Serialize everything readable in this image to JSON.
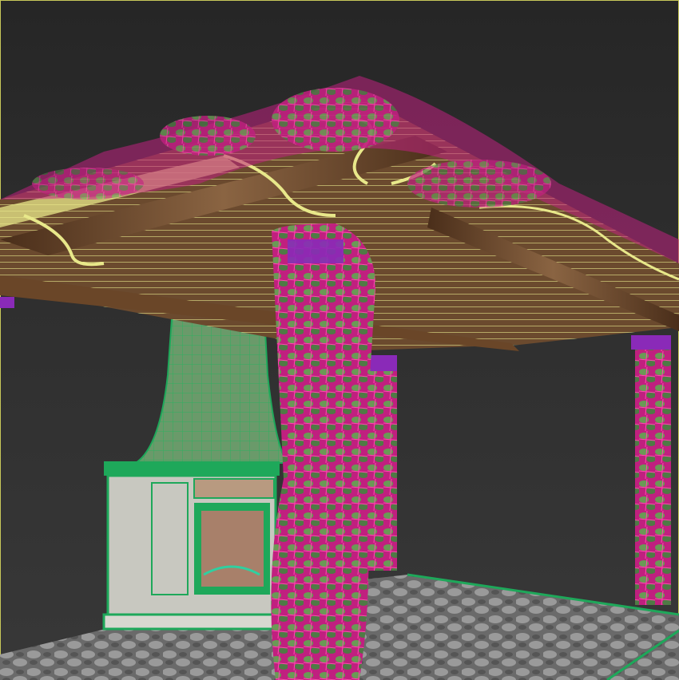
{
  "viewport": {
    "border_color": "#c8c85a",
    "background_color": "#2e2e2e"
  },
  "scene": {
    "colors": {
      "wireframe_yellow": "#e8e88a",
      "wood_dark": "#5a3a22",
      "wood_light": "#8a6442",
      "vine_magenta": "#d0208a",
      "leaf_green": "#5a8a4a",
      "fireplace_green": "#1ea85a",
      "column_purple": "#8a2ab8",
      "floor_gray": "#6e6e6e"
    },
    "objects": [
      "pergola-roof",
      "fireplace-chimney",
      "fireplace-base",
      "vine-column",
      "tile-floor"
    ]
  }
}
